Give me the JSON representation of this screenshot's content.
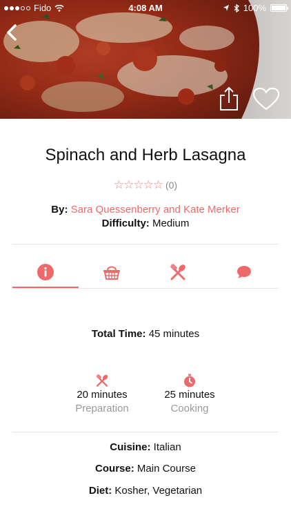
{
  "status_bar": {
    "carrier": "Fido",
    "time": "4:08 AM",
    "battery": "100%",
    "battery_level": 1.0
  },
  "recipe": {
    "title": "Spinach and Herb Lasagna",
    "rating_stars": "☆☆☆☆☆",
    "rating_count": "(0)",
    "rating_value": 0,
    "by_label": "By:",
    "authors": "Sara Quessenberry and Kate Merker",
    "difficulty_label": "Difficulty:",
    "difficulty": "Medium"
  },
  "tabs": [
    {
      "name": "info",
      "icon": "info-icon",
      "active": true
    },
    {
      "name": "ingredients",
      "icon": "basket-icon",
      "active": false
    },
    {
      "name": "directions",
      "icon": "utensils-icon",
      "active": false
    },
    {
      "name": "reviews",
      "icon": "comment-icon",
      "active": false
    }
  ],
  "info": {
    "total_time_label": "Total Time:",
    "total_time": "45 minutes",
    "preparation": {
      "value": "20 minutes",
      "label": "Preparation",
      "icon": "utensils-icon"
    },
    "cooking": {
      "value": "25 minutes",
      "label": "Cooking",
      "icon": "timer-icon"
    },
    "cuisine_label": "Cuisine:",
    "cuisine": "Italian",
    "course_label": "Course:",
    "course": "Main Course",
    "diet_label": "Diet:",
    "diet": "Kosher, Vegetarian"
  },
  "colors": {
    "accent": "#ee6a6a",
    "muted": "#999999",
    "divider": "#e3e3e3"
  }
}
